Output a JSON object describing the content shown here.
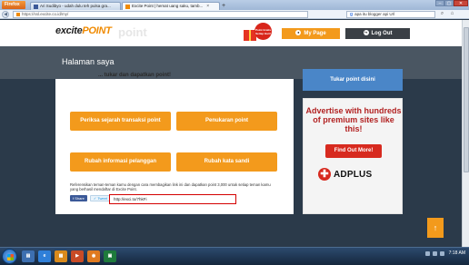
{
  "browser": {
    "app_button": "Firefox",
    "tabs": [
      {
        "label": "Ari Sudibyo - udah dulu teh pulsa gra...",
        "favicon": "facebook"
      },
      {
        "label": "Excite Point | hemat uang saku, tamb...",
        "favicon": "excite"
      }
    ],
    "new_tab": "+",
    "address": "https://ssl.excite.co.id/my/",
    "search_query": "apa itu blogger api Url",
    "window_buttons": [
      "–",
      "▢",
      "✕"
    ]
  },
  "header": {
    "logo_word": "excite",
    "logo_point": "POINT",
    "logo_ghost": "point",
    "gift_badge": "Point Gratis Setiap Hari!",
    "mypage_label": "My Page",
    "logout_label": "Log Out"
  },
  "page": {
    "title": "Halaman saya",
    "hidden_heading": "... tukar dan dapatkan point!"
  },
  "actions": {
    "history": "Periksa sejarah transaksi point",
    "exchange": "Penukaran point",
    "change_info": "Rubah informasi pelanggan",
    "change_password": "Rubah kata sandi"
  },
  "referral": {
    "text": "Referensikan teman-teman kamu dengan cara membagikan link ini dan dapatkan point 3,000 untuk setiap teman kamu yang berhasil mendaftar di Excite Point.",
    "fb_label": "Share",
    "tw_label": "Tweet",
    "link_value": "http://exci.to/7hkFi"
  },
  "sidebar": {
    "tukar_label": "Tukar point disini",
    "ad_headline": "Advertise with hundreds of premium sites like this!",
    "ad_button": "Find Out More!",
    "ad_brand": "ADPLUS"
  },
  "scroll_top_label": "↑",
  "taskbar": {
    "clock": "7:18 AM"
  },
  "colors": {
    "accent_orange": "#f39a1c",
    "blue_button": "#4a86c8",
    "dark_band": "#4a5662",
    "ad_red": "#d72a1f"
  }
}
